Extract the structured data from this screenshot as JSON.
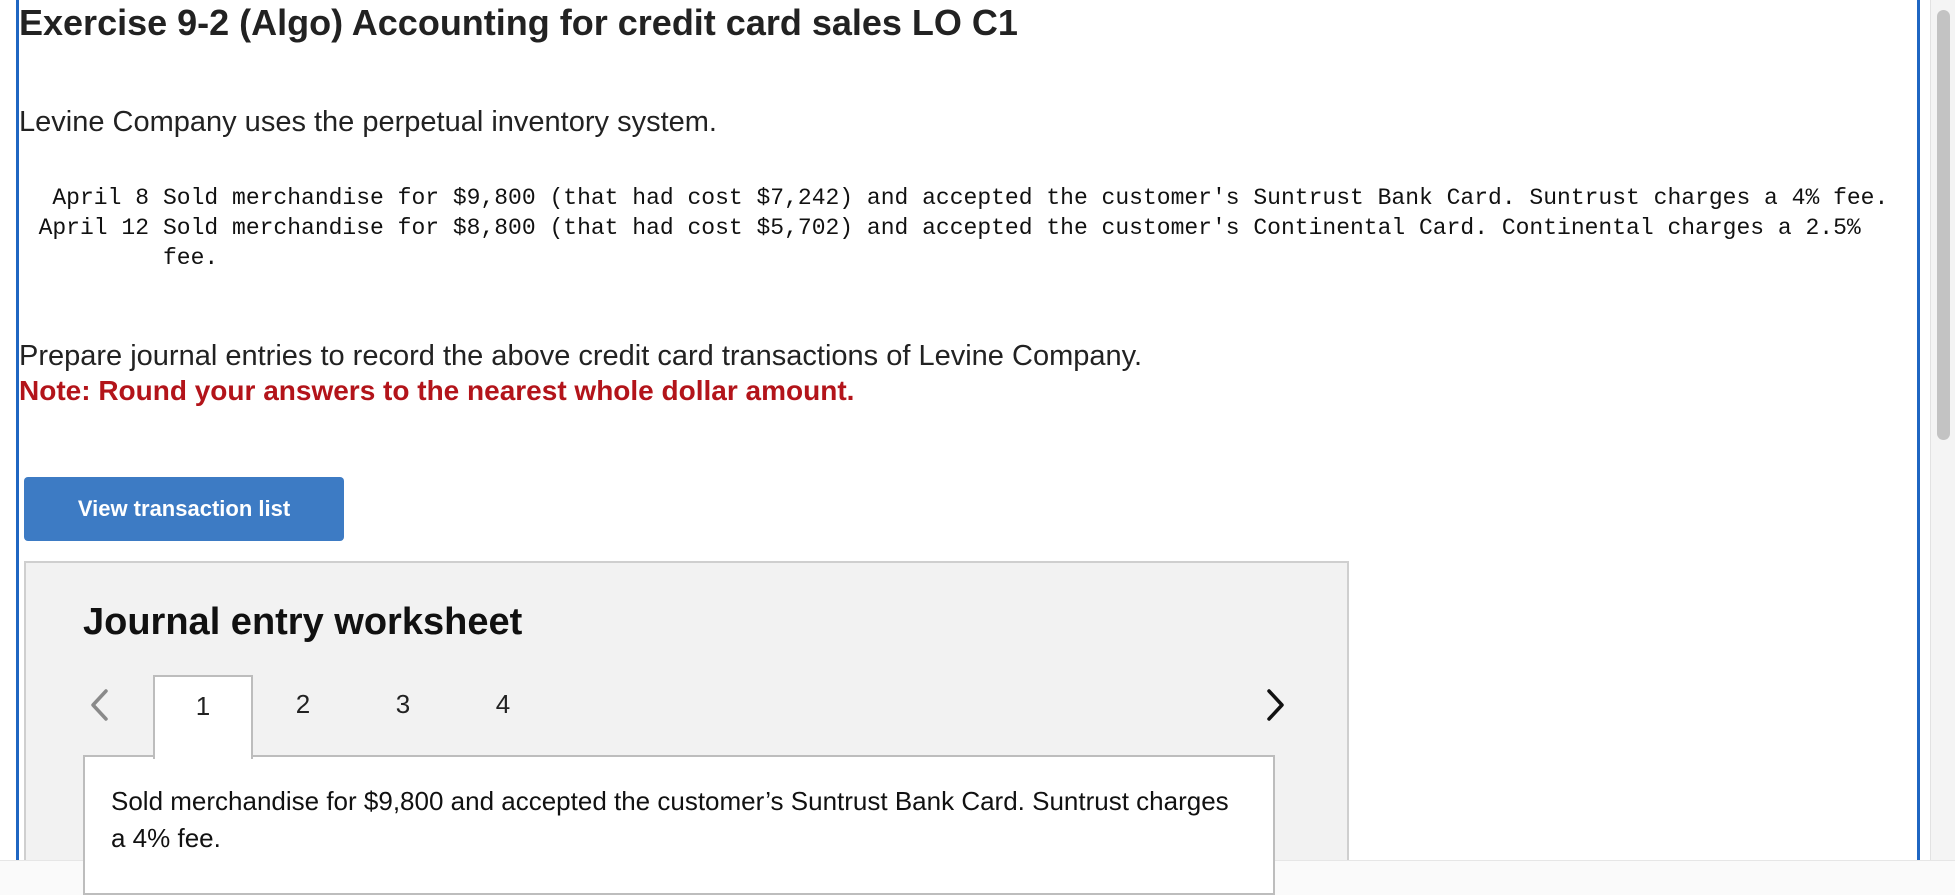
{
  "header": {
    "title": "Exercise 9-2 (Algo) Accounting for credit card sales LO C1"
  },
  "problem": {
    "intro": "Levine Company uses the perpetual inventory system.",
    "transactions": [
      {
        "date": "April 8",
        "description": "Sold merchandise for $9,800 (that had cost $7,242) and accepted the customer's Suntrust Bank Card. Suntrust charges a 4% fee."
      },
      {
        "date": "April 12",
        "description": "Sold merchandise for $8,800 (that had cost $5,702) and accepted the customer's Continental Card. Continental charges a 2.5% fee."
      }
    ],
    "prompt": "Prepare journal entries to record the above credit card transactions of Levine Company.",
    "note": "Note: Round your answers to the nearest whole dollar amount."
  },
  "actions": {
    "view_transactions_label": "View transaction list"
  },
  "worksheet": {
    "title": "Journal entry worksheet",
    "tabs": [
      "1",
      "2",
      "3",
      "4"
    ],
    "active_tab": "1",
    "entry_description": "Sold merchandise for $9,800 and accepted the customer’s Suntrust Bank Card. Suntrust charges a 4% fee."
  },
  "colors": {
    "accent_blue": "#3d7bc4",
    "frame_blue": "#1f66c2",
    "note_red": "#b3141a",
    "worksheet_bg": "#f2f2f2"
  },
  "icons": {
    "prev": "chevron-left-icon",
    "next": "chevron-right-icon"
  }
}
